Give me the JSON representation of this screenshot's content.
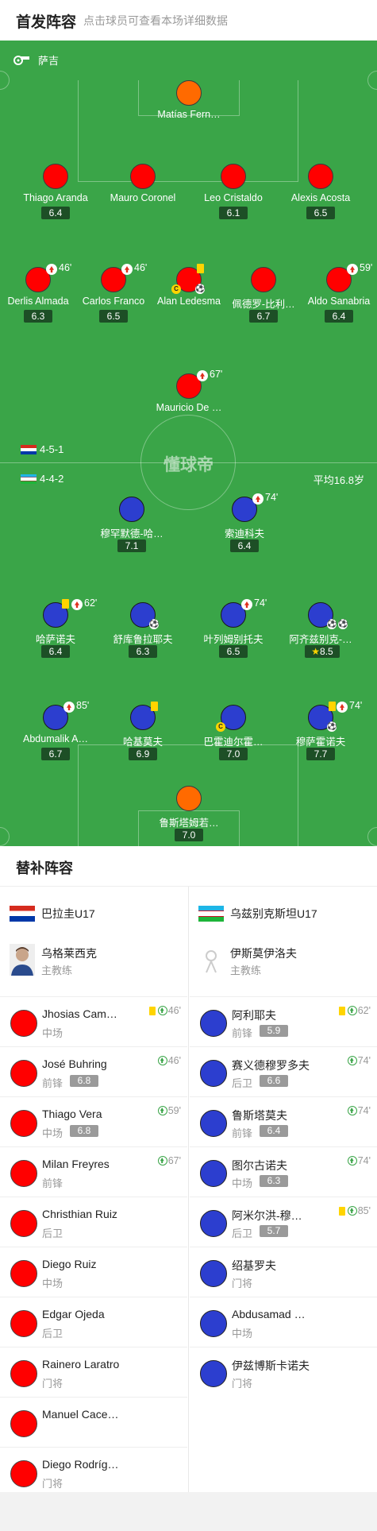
{
  "header": {
    "title": "首发阵容",
    "subtitle": "点击球员可查看本场详细数据"
  },
  "referee": {
    "name": "萨吉"
  },
  "home_team": {
    "formation": "4-5-1",
    "flag": "paraguay-flag"
  },
  "away_team": {
    "formation": "4-4-2",
    "flag": "uzbekistan-flag",
    "avg_age": "平均16.8岁"
  },
  "watermark": "懂球帝",
  "home_players": [
    {
      "name": "Matías Fern…",
      "rating": ""
    },
    {
      "name": "Thiago Aranda",
      "rating": "6.4"
    },
    {
      "name": "Mauro Coronel",
      "rating": ""
    },
    {
      "name": "Leo Cristaldo",
      "rating": "6.1"
    },
    {
      "name": "Alexis Acosta",
      "rating": "6.5"
    },
    {
      "name": "Derlis Almada",
      "rating": "6.3",
      "sub": "46'"
    },
    {
      "name": "Carlos Franco",
      "rating": "6.5",
      "sub": "46'"
    },
    {
      "name": "Alan Ledesma",
      "rating": ""
    },
    {
      "name": "佩德罗-比利…",
      "rating": "6.7"
    },
    {
      "name": "Aldo Sanabria",
      "rating": "6.4",
      "sub": "59'"
    },
    {
      "name": "Mauricio De …",
      "rating": "",
      "sub": "67'"
    }
  ],
  "away_players": [
    {
      "name": "穆罕默德-哈…",
      "rating": "7.1"
    },
    {
      "name": "索迪科夫",
      "rating": "6.4",
      "sub": "74'"
    },
    {
      "name": "哈萨诺夫",
      "rating": "6.4",
      "sub": "62'"
    },
    {
      "name": "舒库鲁拉耶夫",
      "rating": "6.3"
    },
    {
      "name": "叶列姆别托夫",
      "rating": "6.5",
      "sub": "74'"
    },
    {
      "name": "阿齐兹别克-…",
      "rating": "8.5"
    },
    {
      "name": "Abdumalik A…",
      "rating": "6.7",
      "sub": "85'"
    },
    {
      "name": "哈基莫夫",
      "rating": "6.9"
    },
    {
      "name": "巴霍迪尔霍…",
      "rating": "7.0"
    },
    {
      "name": "穆萨霍诺夫",
      "rating": "7.7",
      "sub": "74'"
    },
    {
      "name": "鲁斯塔姆若…",
      "rating": "7.0"
    }
  ],
  "bench": {
    "title": "替补阵容",
    "home": {
      "team": "巴拉圭U17",
      "coach": {
        "name": "乌格莱西克",
        "role": "主教练"
      },
      "players": [
        {
          "name": "Jhosias Cam…",
          "pos": "中场",
          "rating": "",
          "sub": "46'"
        },
        {
          "name": "José Buhring",
          "pos": "前锋",
          "rating": "6.8",
          "sub": "46'"
        },
        {
          "name": "Thiago Vera",
          "pos": "中场",
          "rating": "6.8",
          "sub": "59'"
        },
        {
          "name": "Milan Freyres",
          "pos": "前锋",
          "rating": "",
          "sub": "67'"
        },
        {
          "name": "Christhian Ruiz",
          "pos": "后卫",
          "rating": "",
          "sub": ""
        },
        {
          "name": "Diego Ruiz",
          "pos": "中场",
          "rating": "",
          "sub": ""
        },
        {
          "name": "Edgar Ojeda",
          "pos": "后卫",
          "rating": "",
          "sub": ""
        },
        {
          "name": "Rainero Laratro",
          "pos": "门将",
          "rating": "",
          "sub": ""
        },
        {
          "name": "Manuel Cace…",
          "pos": "",
          "rating": "",
          "sub": ""
        },
        {
          "name": "Diego Rodríg…",
          "pos": "门将",
          "rating": "",
          "sub": ""
        }
      ]
    },
    "away": {
      "team": "乌兹别克斯坦U17",
      "coach": {
        "name": "伊斯莫伊洛夫",
        "role": "主教练"
      },
      "players": [
        {
          "name": "阿利耶夫",
          "pos": "前锋",
          "rating": "5.9",
          "sub": "62'"
        },
        {
          "name": "赛义德穆罗多夫",
          "pos": "后卫",
          "rating": "6.6",
          "sub": "74'"
        },
        {
          "name": "鲁斯塔莫夫",
          "pos": "前锋",
          "rating": "6.4",
          "sub": "74'"
        },
        {
          "name": "图尔古诺夫",
          "pos": "中场",
          "rating": "6.3",
          "sub": "74'"
        },
        {
          "name": "阿米尔洪-穆…",
          "pos": "后卫",
          "rating": "5.7",
          "sub": "85'"
        },
        {
          "name": "绍基罗夫",
          "pos": "门将",
          "rating": "",
          "sub": ""
        },
        {
          "name": "Abdusamad …",
          "pos": "中场",
          "rating": "",
          "sub": ""
        },
        {
          "name": "伊兹博斯卡诺夫",
          "pos": "门将",
          "rating": "",
          "sub": ""
        }
      ]
    }
  },
  "colors": {
    "pitch": "#3aa548",
    "home_dot": "#ff0000",
    "goalkeeper_dot": "#ff6a00",
    "away_dot": "#2c3ecf",
    "rating_bg": "#1d4f26"
  }
}
